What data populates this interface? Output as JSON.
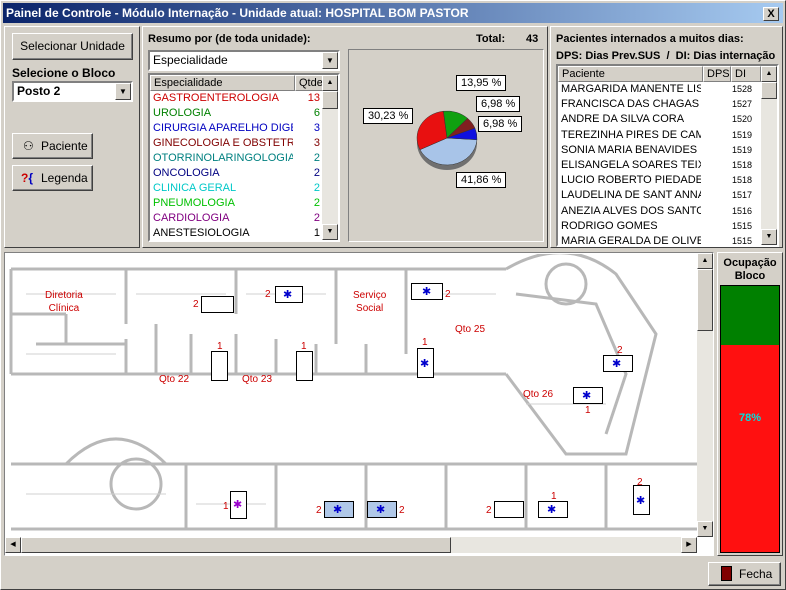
{
  "window": {
    "title": "Painel de Controle - Módulo Internação - Unidade atual: HOSPITAL BOM PASTOR",
    "close": "X"
  },
  "left": {
    "select_unit": "Selecionar Unidade",
    "select_block_label": "Selecione o Bloco",
    "block_value": "Posto 2",
    "patient_btn": "Paciente",
    "legend_btn": "Legenda"
  },
  "summary": {
    "label": "Resumo por (de toda unidade):",
    "total_label": "Total:",
    "total_value": "43",
    "combo_value": "Especialidade",
    "col_specialty": "Especialidade",
    "col_qty": "Qtde",
    "rows": [
      {
        "name": "GASTROENTEROLOGIA",
        "qty": "13",
        "color": "#cc0000"
      },
      {
        "name": "UROLOGIA",
        "qty": "6",
        "color": "#008000"
      },
      {
        "name": "CIRURGIA APARELHO DIGESTIVO",
        "qty": "3",
        "color": "#0000c0"
      },
      {
        "name": "GINECOLOGIA E OBSTETRICIA",
        "qty": "3",
        "color": "#800000"
      },
      {
        "name": "OTORRINOLARINGOLOGIA",
        "qty": "2",
        "color": "#008080"
      },
      {
        "name": "ONCOLOGIA",
        "qty": "2",
        "color": "#000080"
      },
      {
        "name": "CLINICA GERAL",
        "qty": "2",
        "color": "#00c8c8"
      },
      {
        "name": "PNEUMOLOGIA",
        "qty": "2",
        "color": "#00c000"
      },
      {
        "name": "CARDIOLOGIA",
        "qty": "2",
        "color": "#800080"
      },
      {
        "name": "ANESTESIOLOGIA",
        "qty": "1",
        "color": "#000000"
      }
    ]
  },
  "chart_data": {
    "type": "pie",
    "slices": [
      {
        "label": "41,86 %",
        "value": 41.86,
        "color": "#a8c4e8"
      },
      {
        "label": "30,23 %",
        "value": 30.23,
        "color": "#e81010"
      },
      {
        "label": "13,95 %",
        "value": 13.95,
        "color": "#10a010"
      },
      {
        "label": "6,98 %",
        "value": 6.98,
        "color": "#802020"
      },
      {
        "label": "6,98 %",
        "value": 6.98,
        "color": "#1010e0"
      }
    ]
  },
  "patients": {
    "title": "Pacientes internados a muitos dias:",
    "subtitle": "DPS: Dias Prev.SUS  /  DI: Dias internação",
    "col_patient": "Paciente",
    "col_dps": "DPS",
    "col_di": "DI",
    "rows": [
      {
        "name": "MARGARIDA MANENTE LISBOA",
        "di": "1528"
      },
      {
        "name": "FRANCISCA DAS CHAGAS SOUZA",
        "di": "1527"
      },
      {
        "name": "ANDRE DA SILVA CORA",
        "di": "1520"
      },
      {
        "name": "TEREZINHA PIRES DE CAMPOS",
        "di": "1519"
      },
      {
        "name": "SONIA MARIA BENAVIDES FOIZ",
        "di": "1519"
      },
      {
        "name": "ELISANGELA SOARES TEIXEIRA",
        "di": "1518"
      },
      {
        "name": "LUCIO ROBERTO PIEDADE",
        "di": "1518"
      },
      {
        "name": "LAUDELINA DE SANT ANNA",
        "di": "1517"
      },
      {
        "name": "ANEZIA ALVES DOS SANTOS",
        "di": "1516"
      },
      {
        "name": "RODRIGO GOMES",
        "di": "1515"
      },
      {
        "name": "MARIA GERALDA DE OLIVEIRA",
        "di": "1515"
      }
    ]
  },
  "map": {
    "rooms": {
      "diretoria": "Diretoria\nClínica",
      "servico": "Serviço\nSocial",
      "q22": "Qto 22",
      "q23": "Qto 23",
      "q25": "Qto 25",
      "q26": "Qto 26"
    },
    "nums": {
      "n1": "2",
      "n2": "2",
      "n3": "2",
      "n4": "1",
      "n5": "1",
      "n6": "1",
      "n7": "2",
      "n8": "1",
      "n9": "1",
      "n10": "2",
      "n11": "2",
      "n12": "2",
      "n13": "1",
      "n14": "2"
    }
  },
  "occupancy": {
    "title": "Ocupação\nBloco",
    "percent": "78%",
    "fraction": 0.78
  },
  "footer": {
    "close_btn": "Fecha"
  }
}
